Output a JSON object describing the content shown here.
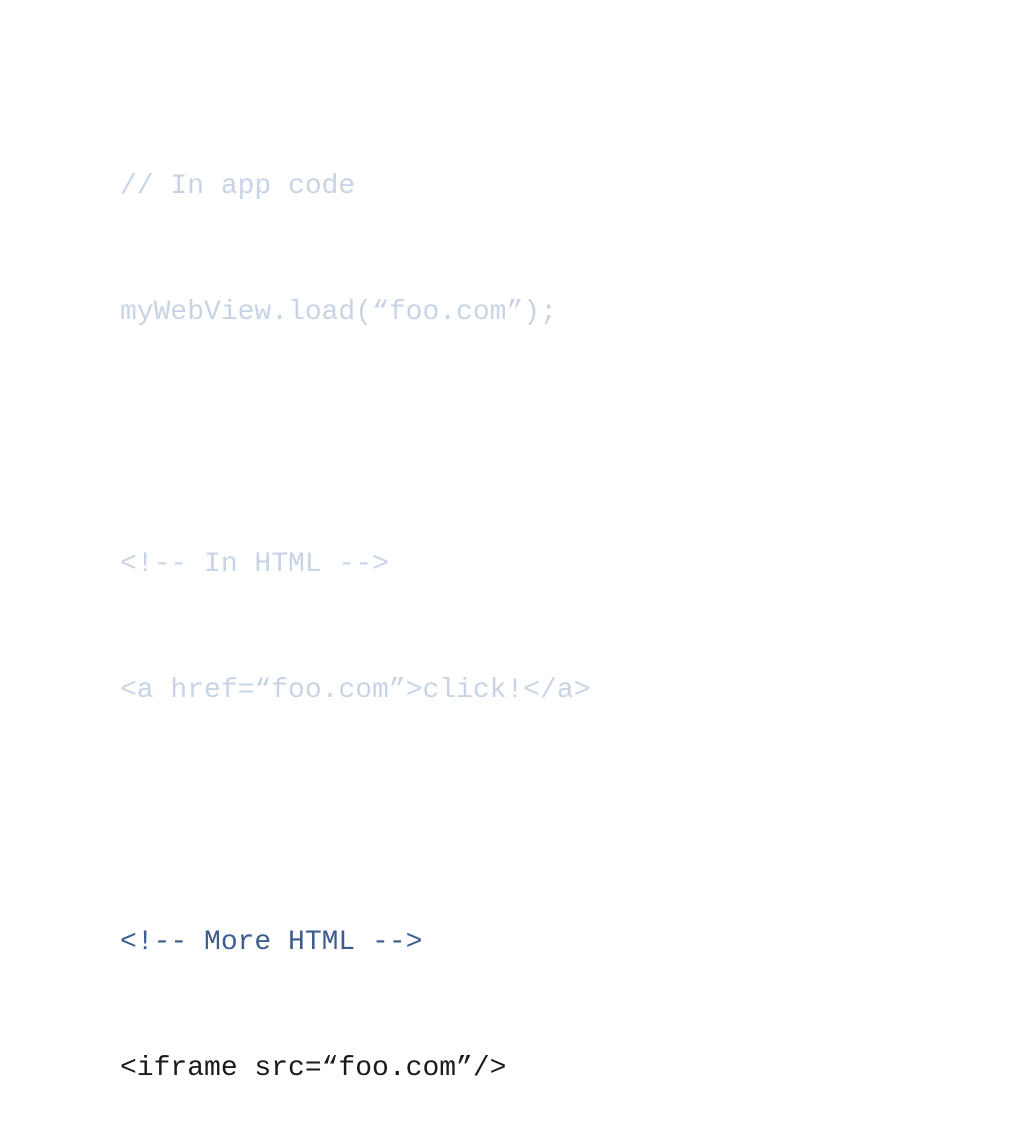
{
  "code": {
    "line1": "// In app code",
    "line2": "myWebView.load(“foo.com”);",
    "line3": "",
    "line4": "<!-- In HTML -->",
    "line5": "<a href=“foo.com”>click!</a>",
    "line6": "",
    "line7": "<!-- More HTML -->",
    "line8": "<iframe src=“foo.com”/>"
  }
}
